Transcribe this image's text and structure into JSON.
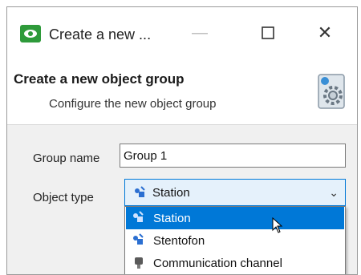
{
  "window": {
    "title": "Create a new ...",
    "minimize_icon": "minimize-icon",
    "maximize_icon": "maximize-icon",
    "close_icon": "close-icon"
  },
  "header": {
    "title": "Create a new object group",
    "subtitle": "Configure the new object group",
    "icon": "settings-gear-icon"
  },
  "form": {
    "group_name_label": "Group name",
    "group_name_value": "Group 1",
    "object_type_label": "Object type",
    "object_type_selected": "Station"
  },
  "dropdown": {
    "options": [
      {
        "label": "Station",
        "icon": "station-icon",
        "selected": true
      },
      {
        "label": "Stentofon",
        "icon": "stentofon-icon",
        "selected": false
      },
      {
        "label": "Communication channel",
        "icon": "communication-channel-icon",
        "selected": false
      }
    ]
  },
  "colors": {
    "accent": "#0078d7",
    "select_bg": "#e5f1fb",
    "app_icon": "#2e9a3a"
  }
}
